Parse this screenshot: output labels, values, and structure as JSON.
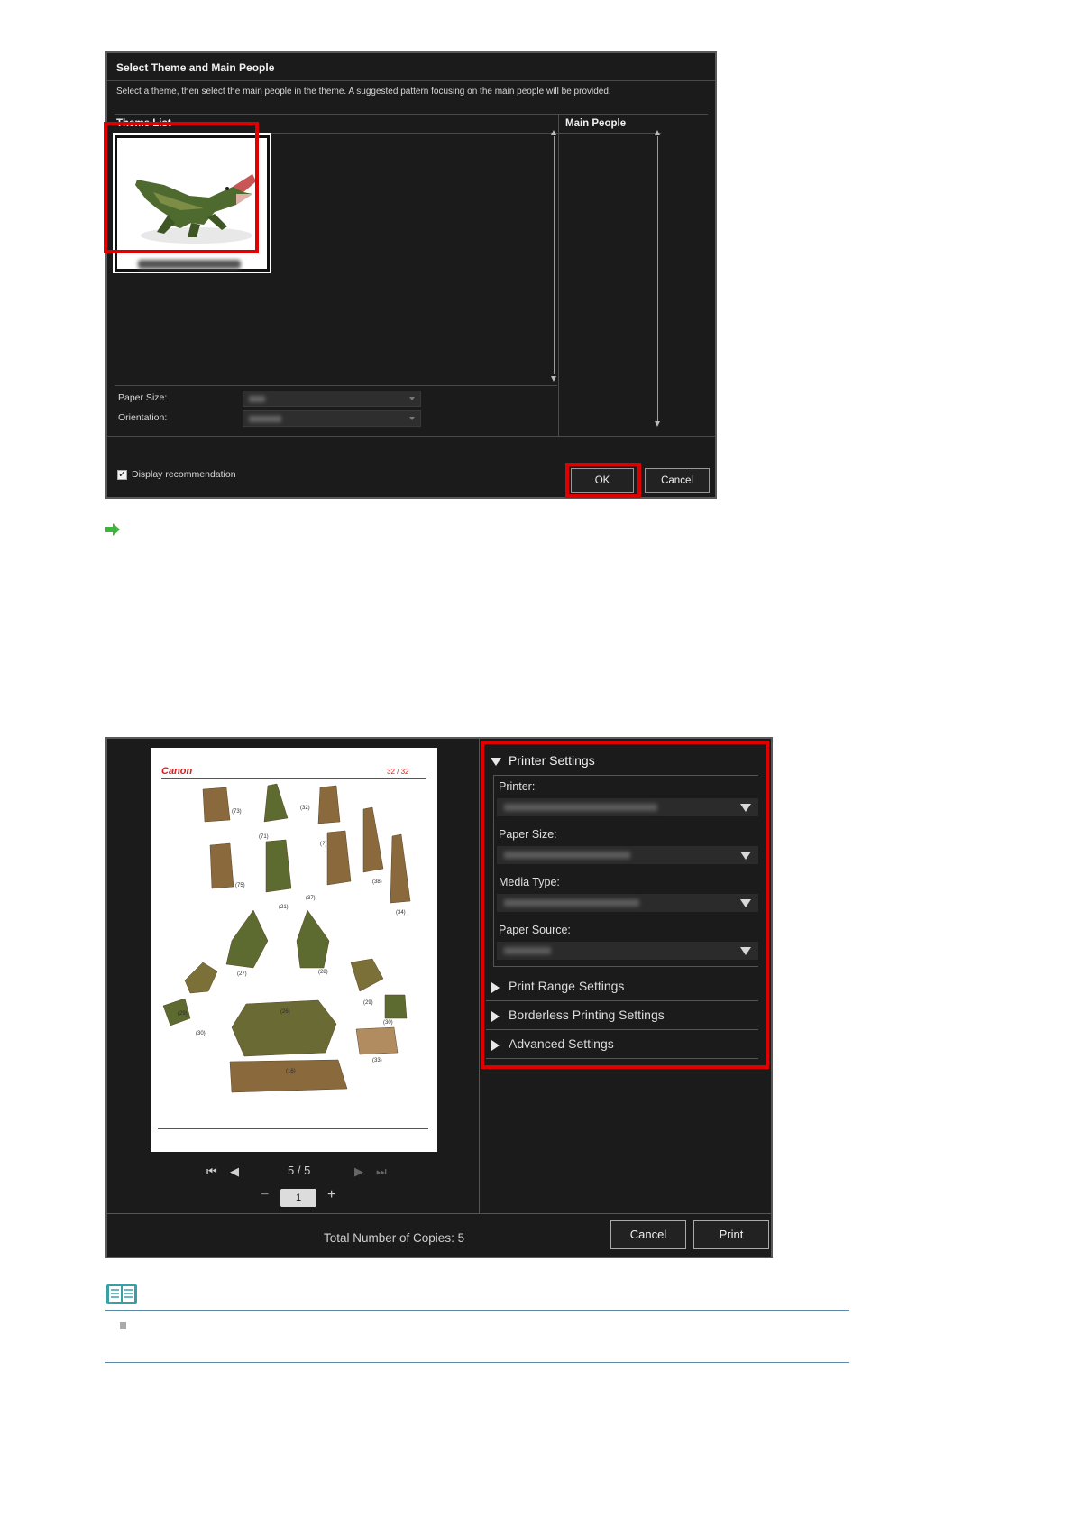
{
  "dialog1": {
    "title": "Select Theme and Main People",
    "description": "Select a theme, then select the main people in the theme. A suggested pattern focusing on the main people will be provided.",
    "theme_list_label": "Theme List",
    "main_people_label": "Main People",
    "paper_size_label": "Paper Size:",
    "orientation_label": "Orientation:",
    "display_recommendation_label": "Display recommendation",
    "display_recommendation_checked": true,
    "ok_label": "OK",
    "cancel_label": "Cancel"
  },
  "dialog2": {
    "page_brand": "Canon",
    "page_number_text": "32 / 32",
    "page_counter": "5 / 5",
    "copies_value": "1",
    "printer_settings_label": "Printer Settings",
    "printer_label": "Printer:",
    "paper_size_label": "Paper Size:",
    "media_type_label": "Media Type:",
    "paper_source_label": "Paper Source:",
    "print_range_label": "Print Range Settings",
    "borderless_label": "Borderless Printing Settings",
    "advanced_label": "Advanced Settings",
    "total_copies_label": "Total Number of Copies:",
    "total_copies_value": "5",
    "cancel_label": "Cancel",
    "print_label": "Print"
  },
  "colors": {
    "highlight": "#e00000",
    "dialog_bg": "#1b1b1b",
    "arrow_green": "#3db53d",
    "note_line": "#5c8aa6"
  }
}
